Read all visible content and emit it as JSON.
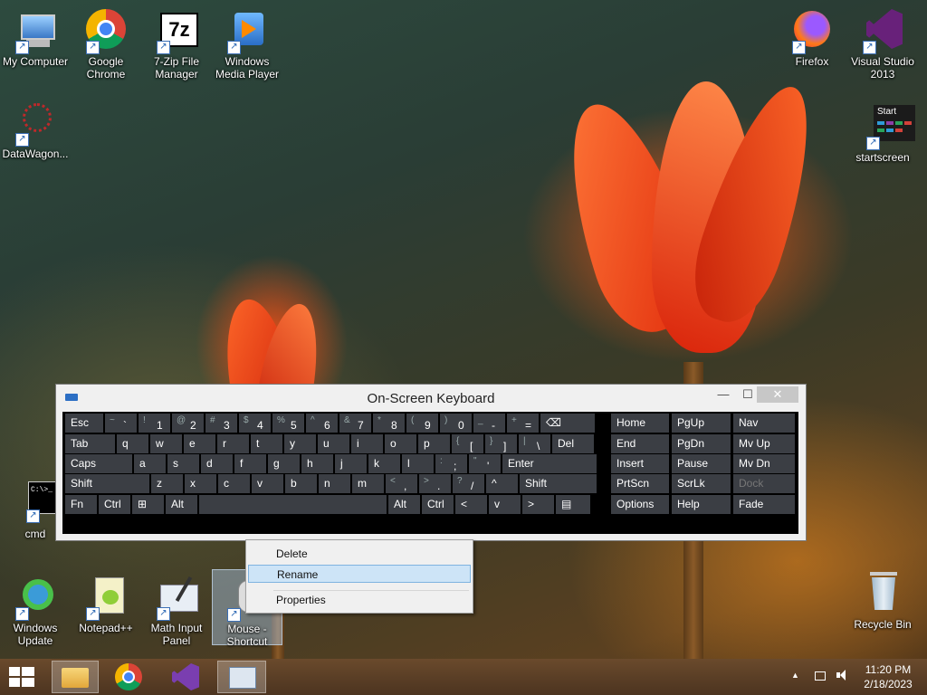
{
  "desktop": {
    "icons_top": [
      {
        "label": "My Computer",
        "icon": "computer-icon"
      },
      {
        "label": "Google Chrome",
        "icon": "chrome-icon"
      },
      {
        "label": "7-Zip File Manager",
        "icon": "7zip-icon"
      },
      {
        "label": "Windows Media Player",
        "icon": "media-player-icon"
      },
      {
        "label": "Firefox",
        "icon": "firefox-icon"
      },
      {
        "label": "Visual Studio 2013",
        "icon": "visual-studio-icon"
      }
    ],
    "datawagon": "DataWagon...",
    "startscreen": {
      "label": "startscreen",
      "thumb_text": "Start"
    },
    "cmd": {
      "label": "cmd",
      "thumb_text": "C:\\>_"
    },
    "icons_bottom": [
      {
        "label": "Windows Update",
        "icon": "windows-update-icon"
      },
      {
        "label": "Notepad++",
        "icon": "notepadpp-icon"
      },
      {
        "label": "Math Input Panel",
        "icon": "math-input-icon"
      },
      {
        "label": "Mouse - Shortcut",
        "icon": "mouse-shortcut-icon"
      }
    ],
    "recycle_bin": "Recycle Bin"
  },
  "osk": {
    "title": "On-Screen Keyboard",
    "minimize": "—",
    "maximize": "☐",
    "close": "✕",
    "rows": [
      [
        {
          "l": "Esc",
          "w": 44
        },
        {
          "s": "~",
          "m": "`",
          "w": 37
        },
        {
          "s": "!",
          "m": "1",
          "w": 37
        },
        {
          "s": "@",
          "m": "2",
          "w": 37
        },
        {
          "s": "#",
          "m": "3",
          "w": 37
        },
        {
          "s": "$",
          "m": "4",
          "w": 37
        },
        {
          "s": "%",
          "m": "5",
          "w": 37
        },
        {
          "s": "^",
          "m": "6",
          "w": 37
        },
        {
          "s": "&",
          "m": "7",
          "w": 37
        },
        {
          "s": "*",
          "m": "8",
          "w": 37
        },
        {
          "s": "(",
          "m": "9",
          "w": 37
        },
        {
          "s": ")",
          "m": "0",
          "w": 37
        },
        {
          "s": "_",
          "m": "-",
          "w": 37
        },
        {
          "s": "+",
          "m": "=",
          "w": 37
        },
        {
          "l": "⌫",
          "w": 62
        }
      ],
      [
        {
          "l": "Tab",
          "w": 57
        },
        {
          "l": "q",
          "w": 37
        },
        {
          "l": "w",
          "w": 37
        },
        {
          "l": "e",
          "w": 37
        },
        {
          "l": "r",
          "w": 37
        },
        {
          "l": "t",
          "w": 37
        },
        {
          "l": "y",
          "w": 37
        },
        {
          "l": "u",
          "w": 37
        },
        {
          "l": "i",
          "w": 37
        },
        {
          "l": "o",
          "w": 37
        },
        {
          "l": "p",
          "w": 37
        },
        {
          "s": "{",
          "m": "[",
          "w": 37
        },
        {
          "s": "}",
          "m": "]",
          "w": 37
        },
        {
          "s": "|",
          "m": "\\",
          "w": 37
        },
        {
          "l": "Del",
          "w": 48
        }
      ],
      [
        {
          "l": "Caps",
          "w": 76
        },
        {
          "l": "a",
          "w": 37
        },
        {
          "l": "s",
          "w": 37
        },
        {
          "l": "d",
          "w": 37
        },
        {
          "l": "f",
          "w": 37
        },
        {
          "l": "g",
          "w": 37
        },
        {
          "l": "h",
          "w": 37
        },
        {
          "l": "j",
          "w": 37
        },
        {
          "l": "k",
          "w": 37
        },
        {
          "l": "l",
          "w": 37
        },
        {
          "s": ":",
          "m": ";",
          "w": 37
        },
        {
          "s": "\"",
          "m": "'",
          "w": 37
        },
        {
          "l": "Enter",
          "w": 106
        }
      ],
      [
        {
          "l": "Shift",
          "w": 95
        },
        {
          "l": "z",
          "w": 37
        },
        {
          "l": "x",
          "w": 37
        },
        {
          "l": "c",
          "w": 37
        },
        {
          "l": "v",
          "w": 37
        },
        {
          "l": "b",
          "w": 37
        },
        {
          "l": "n",
          "w": 37
        },
        {
          "l": "m",
          "w": 37
        },
        {
          "s": "<",
          "m": ",",
          "w": 37
        },
        {
          "s": ">",
          "m": ".",
          "w": 37
        },
        {
          "s": "?",
          "m": "/",
          "w": 37
        },
        {
          "l": "^",
          "w": 37
        },
        {
          "l": "Shift",
          "w": 87
        }
      ],
      [
        {
          "l": "Fn",
          "w": 37
        },
        {
          "l": "Ctrl",
          "w": 37
        },
        {
          "l": "⊞",
          "w": 37
        },
        {
          "l": "Alt",
          "w": 37
        },
        {
          "l": "",
          "w": 209
        },
        {
          "l": "Alt",
          "w": 37
        },
        {
          "l": "Ctrl",
          "w": 37
        },
        {
          "l": "<",
          "w": 37
        },
        {
          "l": "v",
          "w": 37
        },
        {
          "l": ">",
          "w": 37
        },
        {
          "l": "▤",
          "w": 40
        }
      ]
    ],
    "nav_rows": [
      [
        "Home",
        "PgUp",
        "Nav"
      ],
      [
        "End",
        "PgDn",
        "Mv Up"
      ],
      [
        "Insert",
        "Pause",
        "Mv Dn"
      ],
      [
        "PrtScn",
        "ScrLk",
        "Dock"
      ],
      [
        "Options",
        "Help",
        "Fade"
      ]
    ]
  },
  "context_menu": {
    "items": [
      "Delete",
      "Rename",
      "Properties"
    ],
    "highlighted": "Rename"
  },
  "taskbar": {
    "apps": [
      "file-explorer-icon",
      "chrome-icon",
      "visual-studio-icon",
      "osk-icon"
    ],
    "tray_arrow": "▲",
    "time": "11:20 PM",
    "date": "2/18/2023"
  },
  "colors": {
    "key_bg": "#3b3e44",
    "highlight": "#cde4f7",
    "taskbar": "#5a3e26"
  }
}
